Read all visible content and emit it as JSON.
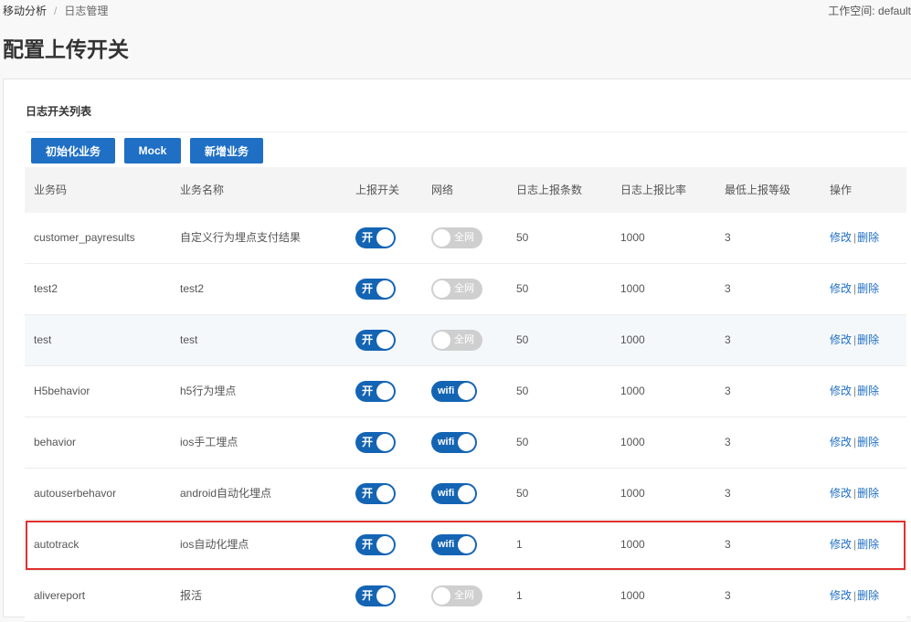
{
  "breadcrumb": {
    "root": "移动分析",
    "current": "日志管理"
  },
  "workspace": {
    "label": "工作空间: ",
    "value": "default"
  },
  "page": {
    "title": "配置上传开关"
  },
  "card": {
    "title": "日志开关列表"
  },
  "toolbar": {
    "init_label": "初始化业务",
    "mock_label": "Mock",
    "add_label": "新增业务"
  },
  "columns": [
    "业务码",
    "业务名称",
    "上报开关",
    "网络",
    "日志上报条数",
    "日志上报比率",
    "最低上报等级",
    "操作"
  ],
  "actions": {
    "edit": "修改",
    "separator": "|",
    "delete": "删除"
  },
  "rows": [
    {
      "code": "customer_payresults",
      "name": "自定义行为埋点支付结果",
      "report": "开",
      "network": "全网",
      "count": "50",
      "ratio": "1000",
      "level": "3"
    },
    {
      "code": "test2",
      "name": "test2",
      "report": "开",
      "network": "全网",
      "count": "50",
      "ratio": "1000",
      "level": "3"
    },
    {
      "code": "test",
      "name": "test",
      "report": "开",
      "network": "全网",
      "count": "50",
      "ratio": "1000",
      "level": "3"
    },
    {
      "code": "H5behavior",
      "name": "h5行为埋点",
      "report": "开",
      "network": "wifi",
      "count": "50",
      "ratio": "1000",
      "level": "3"
    },
    {
      "code": "behavior",
      "name": "ios手工埋点",
      "report": "开",
      "network": "wifi",
      "count": "50",
      "ratio": "1000",
      "level": "3"
    },
    {
      "code": "autouserbehavor",
      "name": "android自动化埋点",
      "report": "开",
      "network": "wifi",
      "count": "50",
      "ratio": "1000",
      "level": "3"
    },
    {
      "code": "autotrack",
      "name": "ios自动化埋点",
      "report": "开",
      "network": "wifi",
      "count": "1",
      "ratio": "1000",
      "level": "3"
    },
    {
      "code": "alivereport",
      "name": "报活",
      "report": "开",
      "network": "全网",
      "count": "1",
      "ratio": "1000",
      "level": "3"
    }
  ],
  "colors": {
    "primary": "#1f6fc5",
    "toggle_on": "#1464b4",
    "toggle_off": "#cfcfcf",
    "highlight_border": "#e0302e"
  }
}
